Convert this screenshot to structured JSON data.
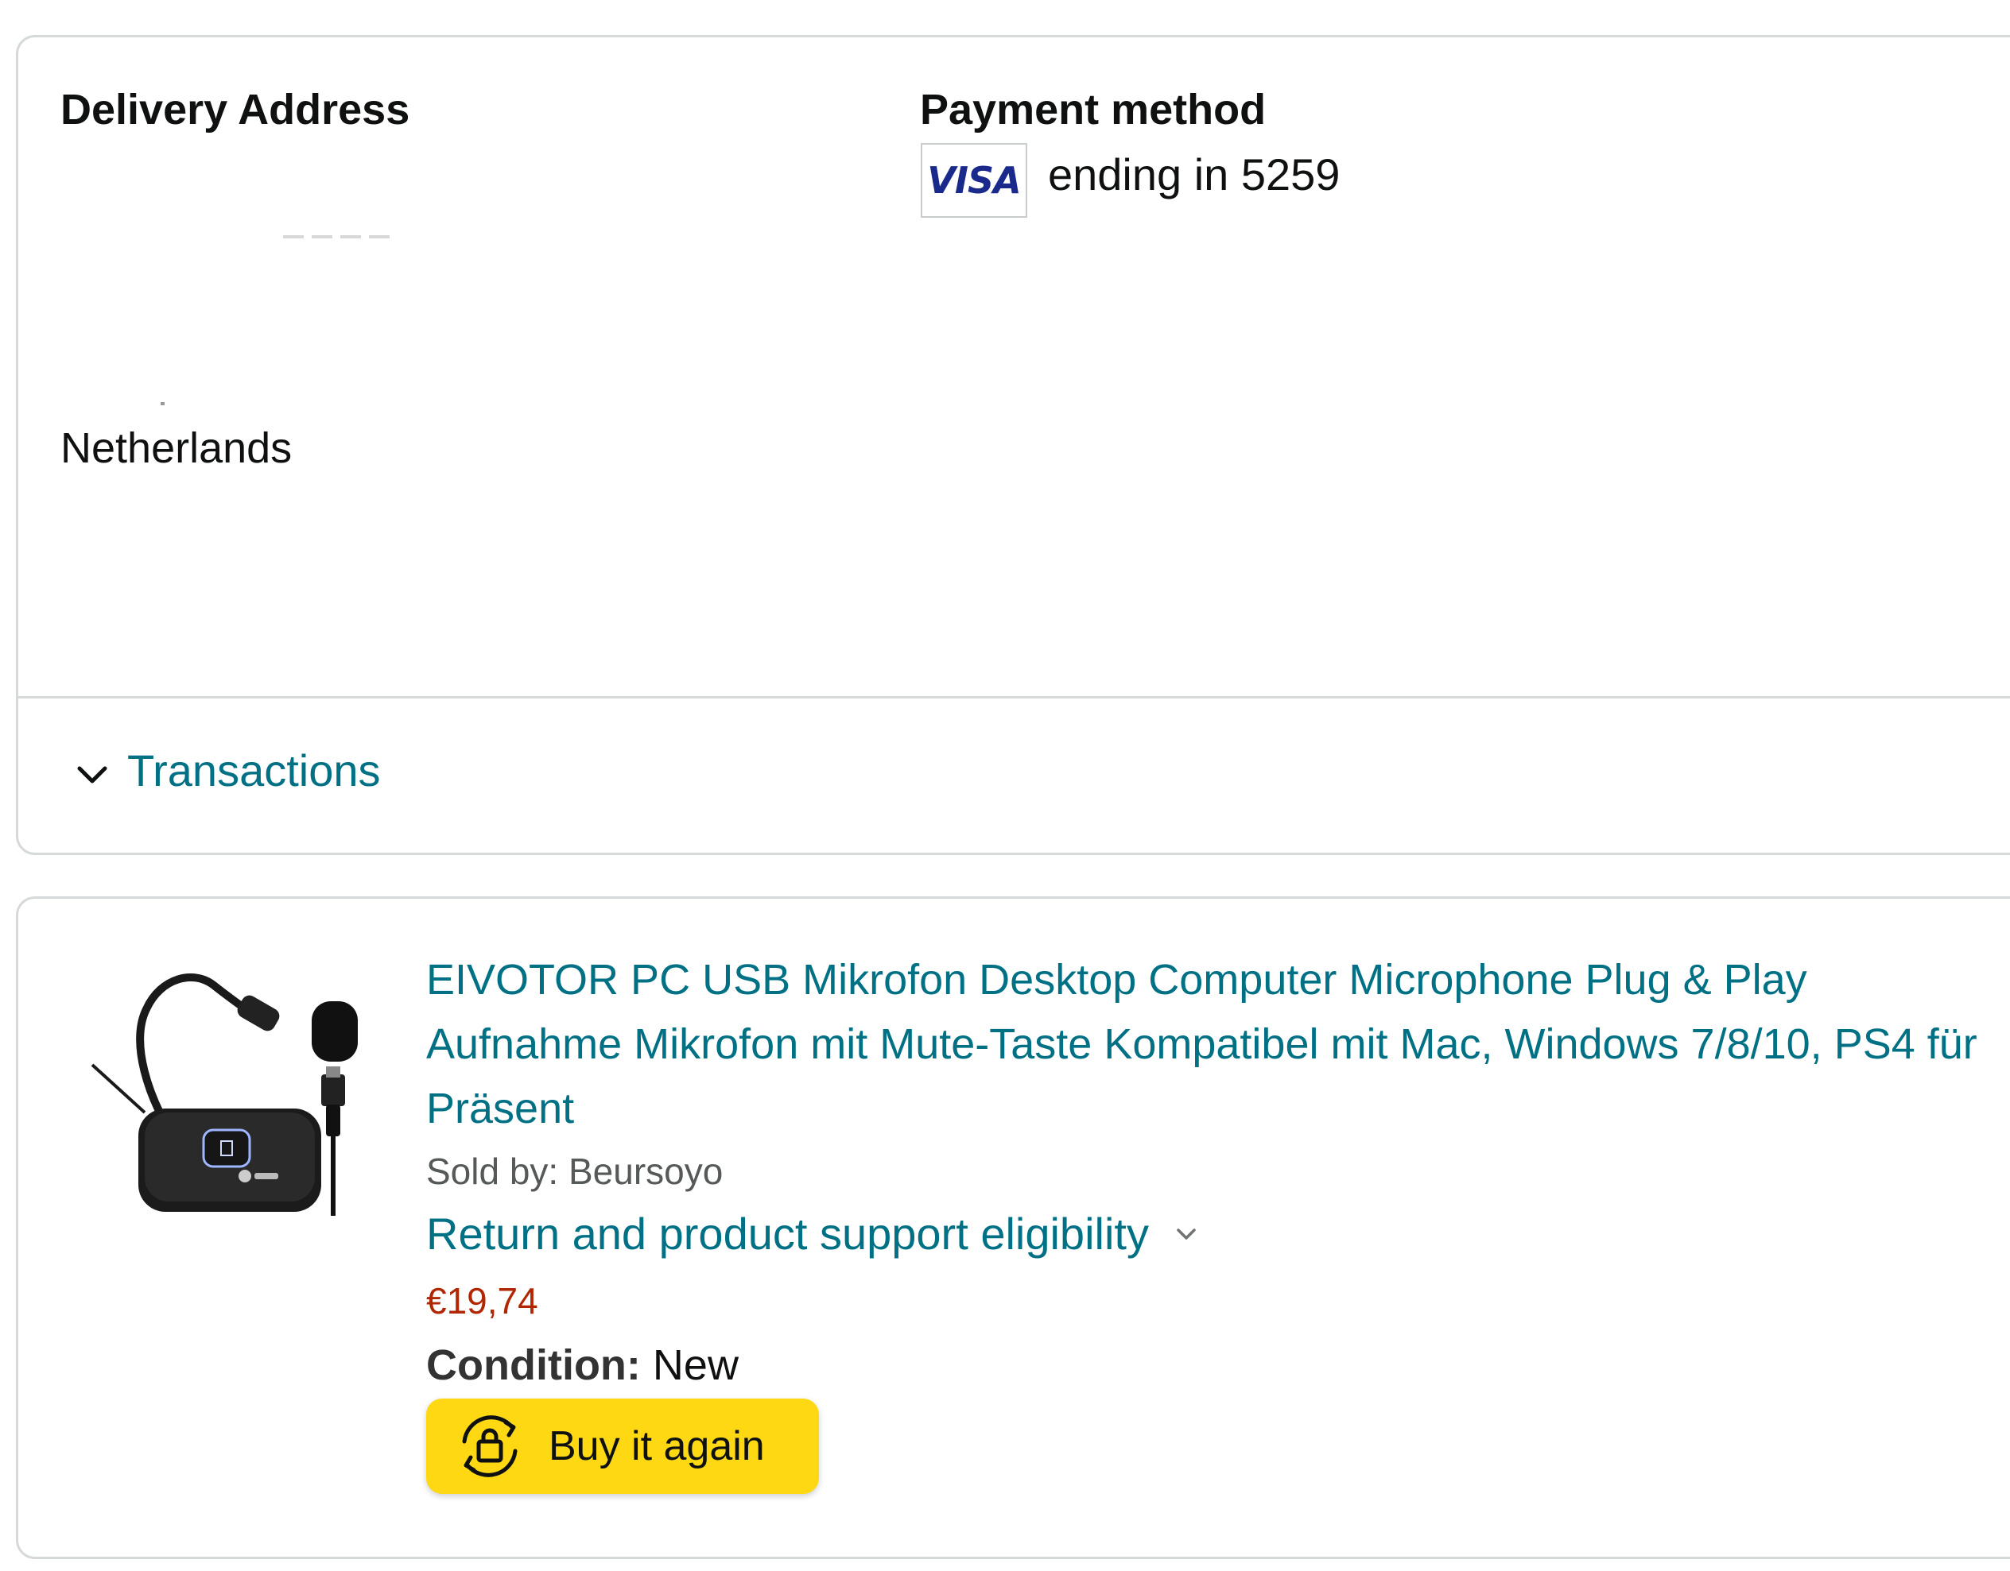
{
  "order_details": {
    "delivery_heading": "Delivery Address",
    "delivery_country": "Netherlands",
    "payment_heading": "Payment method",
    "card_brand": "VISA",
    "card_ending_text": "ending in 5259",
    "transactions_label": "Transactions"
  },
  "item": {
    "title": "EIVOTOR PC USB Mikrofon Desktop Computer Microphone Plug & Play Aufnahme Mikrofon mit Mute-Taste Kompatibel mit Mac, Windows 7/8/10, PS4 für Präsent",
    "sold_by": "Sold by: Beursoyo",
    "return_label": "Return and product support eligibility",
    "price": "€19,74",
    "condition_label": "Condition:",
    "condition_value": "New",
    "buy_again_label": "Buy it again"
  },
  "icons": {
    "transactions_toggle": "chevron-down-icon",
    "return_toggle": "chevron-down-icon",
    "buy_again": "reorder-bag-icon",
    "payment": "visa-icon"
  },
  "colors": {
    "link": "#007185",
    "price": "#b12704",
    "button": "#ffd814",
    "border": "#d5d9d9"
  }
}
